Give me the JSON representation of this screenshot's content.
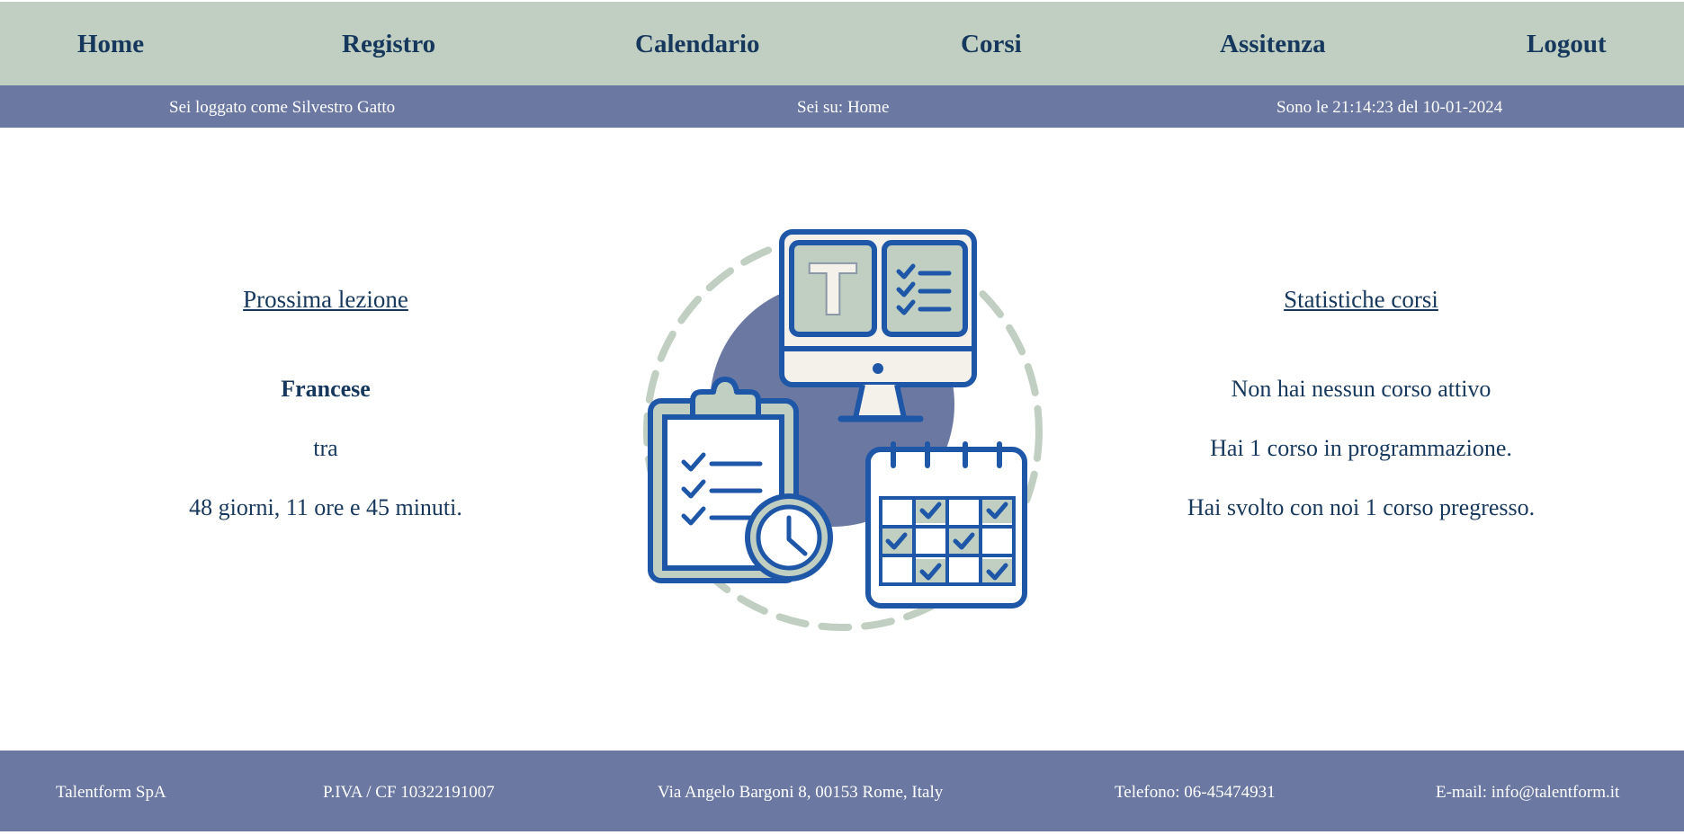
{
  "nav": {
    "home": "Home",
    "registro": "Registro",
    "calendario": "Calendario",
    "corsi": "Corsi",
    "assistenza": "Assitenza",
    "logout": "Logout"
  },
  "infobar": {
    "user": "Sei loggato come Silvestro Gatto",
    "location": "Sei su:  Home",
    "datetime": "Sono le 21:14:23 del 10-01-2024"
  },
  "next_lesson": {
    "heading": "Prossima lezione",
    "course": "Francese",
    "between": "tra",
    "countdown": "48 giorni, 11 ore e 45 minuti."
  },
  "stats": {
    "heading": "Statistiche corsi",
    "active": "Non hai nessun corso attivo",
    "scheduled": "Hai 1 corso in programmazione.",
    "past": "Hai svolto con noi 1 corso pregresso."
  },
  "illustration": {
    "logo_letter": "T",
    "icons": [
      "monitor-icon",
      "clipboard-icon",
      "clock-icon",
      "calendar-icon"
    ]
  },
  "colors": {
    "nav_bg": "#c0cfc1",
    "bar_bg": "#6b79a2",
    "text_dark": "#17385d",
    "icon_blue": "#1f57a8"
  },
  "footer": {
    "company": "Talentform SpA",
    "vat": "P.IVA / CF 10322191007",
    "address": "Via Angelo Bargoni 8, 00153 Rome, Italy",
    "phone": "Telefono: 06-45474931",
    "email": "E-mail: info@talentform.it"
  }
}
